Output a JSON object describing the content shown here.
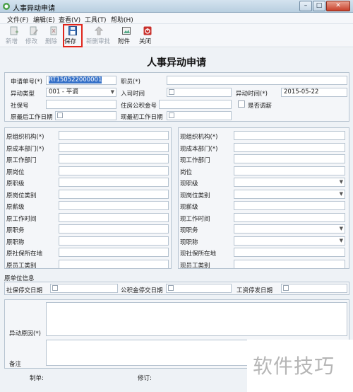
{
  "window": {
    "title": "人事异动申请",
    "minimize": "–",
    "maximize": "□",
    "close": "✕"
  },
  "menu": [
    "文件(F)",
    "编辑(E)",
    "查看(V)",
    "工具(T)",
    "帮助(H)"
  ],
  "toolbar": {
    "new": "新增",
    "edit": "修改",
    "delete": "删除",
    "save": "保存",
    "recheck": "新删审批",
    "attach": "附件",
    "close": "关闭"
  },
  "form": {
    "title": "人事异动申请",
    "top": {
      "apply_no_label": "申请单号(*)",
      "apply_no_value": "RT150522000001",
      "employee_label": "职员(*)",
      "change_type_label": "异动类型",
      "change_type_value": "001 - 平调",
      "entry_date_label": "入司时间",
      "change_date_label": "异动时间(*)",
      "change_date_value": "2015-05-22",
      "social_no_label": "社保号",
      "housing_no_label": "住房公积金号",
      "is_adjust_label": "是否调薪",
      "orig_last_workday_label": "原最后工作日期",
      "new_first_workday_label": "现最初工作日期"
    },
    "orig": [
      "原组织机构(*)",
      "原成本部门(*)",
      "原工作部门",
      "原岗位",
      "原职级",
      "原岗位类别",
      "原薪级",
      "原工作时间",
      "原职务",
      "原职称",
      "原社保所在地",
      "原员工类别"
    ],
    "curr": [
      "现组织机构(*)",
      "现成本部门(*)",
      "现工作部门",
      "岗位",
      "现职级",
      "现岗位类别",
      "现薪级",
      "现工作时间",
      "现职务",
      "现职称",
      "现社保所在地",
      "现员工类别"
    ],
    "orig_unit": {
      "header": "原单位信息",
      "social_stop_label": "社保停交日期",
      "fund_stop_label": "公积金停交日期",
      "salary_stop_label": "工资停发日期"
    },
    "reason_label": "异动原因(*)",
    "remark_label": "备注",
    "footer": {
      "maker_label": "制单:",
      "modifier_label": "修订:"
    }
  },
  "watermark": "软件技巧"
}
